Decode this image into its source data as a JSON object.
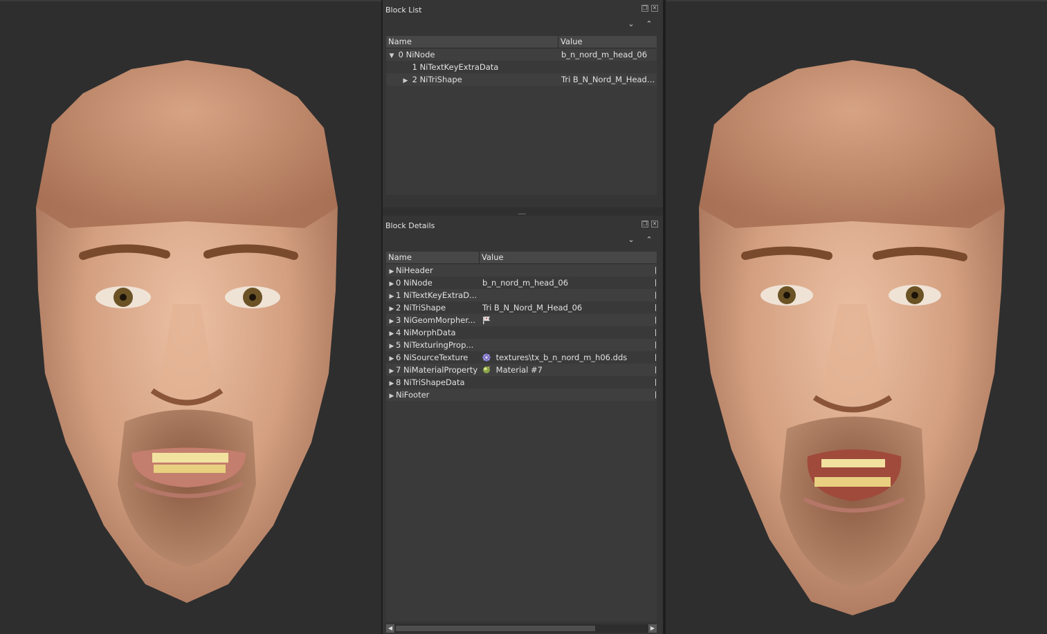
{
  "block_list": {
    "title": "Block List",
    "columns": [
      "Name",
      "Value"
    ],
    "rows": [
      {
        "expander": "▼",
        "name": "0 NiNode",
        "value": "b_n_nord_m_head_06"
      },
      {
        "expander": "",
        "name": "1 NiTextKeyExtraData",
        "value": ""
      },
      {
        "expander": "▶",
        "name": "2 NiTriShape",
        "value": "Tri B_N_Nord_M_Head_..."
      }
    ]
  },
  "block_details": {
    "title": "Block Details",
    "columns": [
      "Name",
      "Value"
    ],
    "rows": [
      {
        "name": "NiHeader",
        "value": ""
      },
      {
        "name": "0 NiNode",
        "value": "b_n_nord_m_head_06"
      },
      {
        "name": "1 NiTextKeyExtraD...",
        "value": ""
      },
      {
        "name": "2 NiTriShape",
        "value": "Tri B_N_Nord_M_Head_06"
      },
      {
        "name": "3 NiGeomMorpher...",
        "value": ""
      },
      {
        "name": "4 NiMorphData",
        "value": ""
      },
      {
        "name": "5 NiTexturingProp...",
        "value": ""
      },
      {
        "name": "6 NiSourceTexture",
        "value": "textures\\tx_b_n_nord_m_h06.dds"
      },
      {
        "name": "7 NiMaterialProperty",
        "value": "Material #7"
      },
      {
        "name": "8 NiTriShapeData",
        "value": ""
      },
      {
        "name": "NiFooter",
        "value": ""
      }
    ]
  },
  "icons": {
    "float": "float-icon",
    "close": "close-icon",
    "expand_all": "expand-all-icon",
    "collapse_all": "collapse-all-icon",
    "geom_morpher": "flag-icon",
    "source_texture": "texture-icon",
    "material": "material-icon"
  },
  "colors": {
    "background": "#2e2e2e",
    "panel": "#353535",
    "skin": "#d9a78a"
  }
}
